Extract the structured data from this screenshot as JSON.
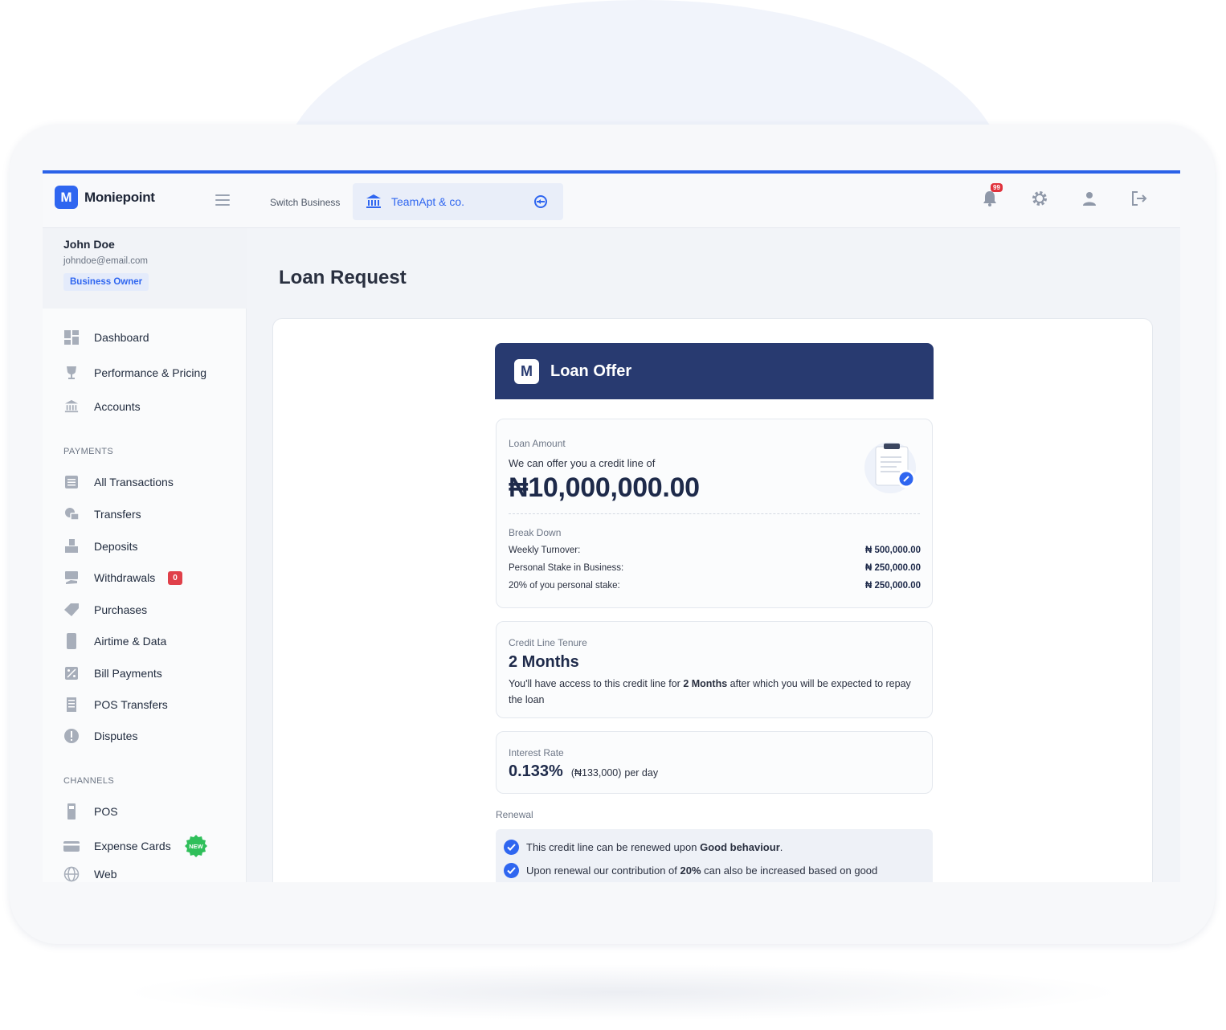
{
  "brand": {
    "logo_letter": "M",
    "name": "Moniepoint"
  },
  "header": {
    "switch_label": "Switch Business",
    "business_name": "TeamApt & co.",
    "notification_count": "99"
  },
  "user": {
    "name": "John Doe",
    "email": "johndoe@email.com",
    "role": "Business Owner"
  },
  "sidebar": {
    "main_items": [
      {
        "label": "Dashboard",
        "icon": "dashboard-icon"
      },
      {
        "label": "Performance & Pricing",
        "icon": "trophy-icon"
      },
      {
        "label": "Accounts",
        "icon": "bank-icon"
      }
    ],
    "payments_title": "PAYMENTS",
    "payments_items": [
      {
        "label": "All Transactions",
        "icon": "list-icon"
      },
      {
        "label": "Transfers",
        "icon": "transfer-icon"
      },
      {
        "label": "Deposits",
        "icon": "deposit-icon"
      },
      {
        "label": "Withdrawals",
        "icon": "withdrawal-icon",
        "badge": "0"
      },
      {
        "label": "Purchases",
        "icon": "tag-icon"
      },
      {
        "label": "Airtime & Data",
        "icon": "phone-icon"
      },
      {
        "label": "Bill Payments",
        "icon": "bill-icon"
      },
      {
        "label": "POS Transfers",
        "icon": "receipt-icon"
      },
      {
        "label": "Disputes",
        "icon": "alert-icon"
      }
    ],
    "channels_title": "CHANNELS",
    "channels_items": [
      {
        "label": "POS",
        "icon": "pos-icon"
      },
      {
        "label": "Expense Cards",
        "icon": "card-icon",
        "badge": "NEW"
      },
      {
        "label": "Web",
        "icon": "globe-icon"
      }
    ]
  },
  "page": {
    "title": "Loan Request"
  },
  "offer": {
    "title": "Loan Offer",
    "amount_label": "Loan Amount",
    "amount_intro": "We can offer you a credit line of",
    "amount": "₦10,000,000.00",
    "breakdown_label": "Break Down",
    "breakdown": [
      {
        "label": "Weekly Turnover:",
        "value": "₦ 500,000.00"
      },
      {
        "label": "Personal Stake in Business:",
        "value": "₦ 250,000.00"
      },
      {
        "label": "20% of you personal stake:",
        "value": "₦ 250,000.00"
      }
    ],
    "tenure_label": "Credit Line Tenure",
    "tenure_value": "2 Months",
    "tenure_desc_before": "You'll have access to this credit line for ",
    "tenure_desc_bold": "2 Months",
    "tenure_desc_after": " after which you will be expected to repay the loan",
    "rate_label": "Interest Rate",
    "rate_value": "0.133%",
    "rate_amount": "(₦133,000)",
    "rate_unit": "per day",
    "renewal_label": "Renewal",
    "renewal_1_before": "This credit line can be renewed upon ",
    "renewal_1_bold": "Good behaviour",
    "renewal_1_after": ".",
    "renewal_2_before": "Upon renewal our contribution of ",
    "renewal_2_bold": "20%",
    "renewal_2_after": " can also be increased based on good"
  },
  "colors": {
    "accent": "#2f66f0",
    "offer_header": "#283a70",
    "badge_red": "#e0404a",
    "new_green": "#2fbf5a"
  }
}
